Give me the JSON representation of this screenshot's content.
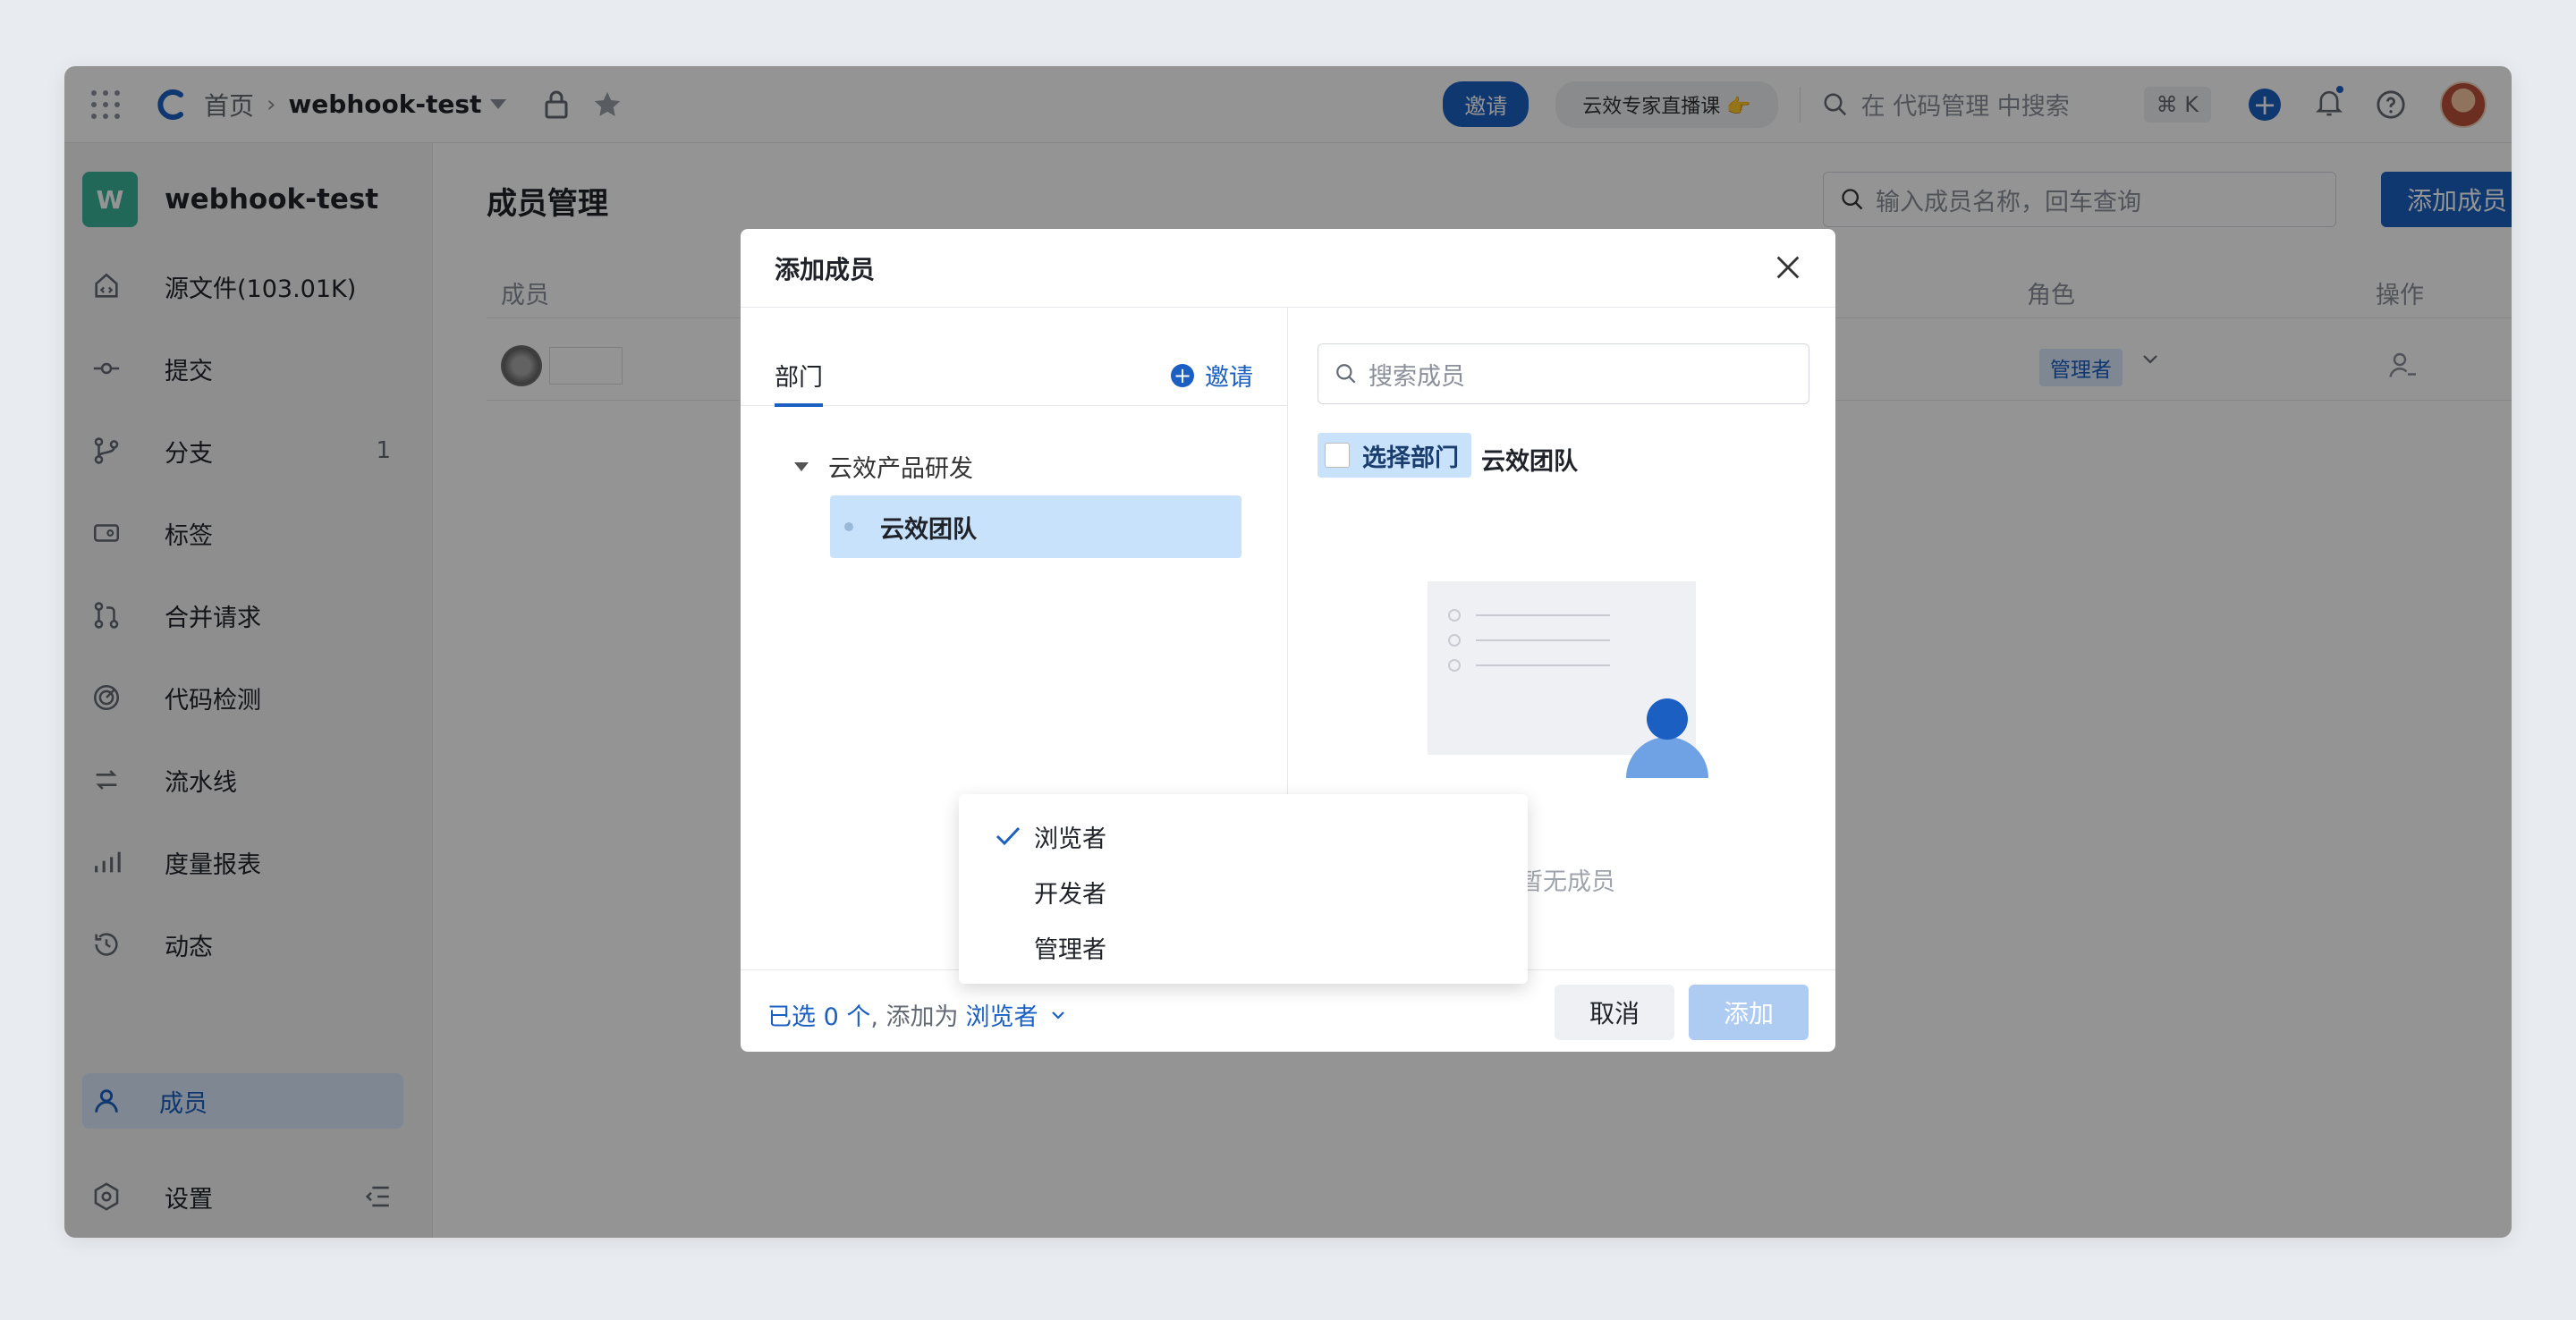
{
  "topbar": {
    "home": "首页",
    "repo": "webhook-test",
    "invite": "邀请",
    "promo": "云效专家直播课 👉",
    "search_placeholder": "在 代码管理 中搜索",
    "shortcut": "⌘ K"
  },
  "sidebar": {
    "repo_initial": "W",
    "repo_name": "webhook-test",
    "items": [
      {
        "label": "源文件(103.01K)",
        "icon": "file-code-icon"
      },
      {
        "label": "提交",
        "icon": "commit-icon"
      },
      {
        "label": "分支",
        "icon": "branch-icon",
        "count": "1"
      },
      {
        "label": "标签",
        "icon": "tag-icon"
      },
      {
        "label": "合并请求",
        "icon": "merge-request-icon"
      },
      {
        "label": "代码检测",
        "icon": "code-scan-icon"
      },
      {
        "label": "流水线",
        "icon": "pipeline-icon"
      },
      {
        "label": "度量报表",
        "icon": "bar-chart-icon"
      },
      {
        "label": "动态",
        "icon": "history-icon"
      }
    ],
    "members": "成员",
    "settings": "设置"
  },
  "main": {
    "title": "成员管理",
    "search_placeholder": "输入成员名称，回车查询",
    "add_member": "添加成员",
    "columns": {
      "member": "成员",
      "role": "角色",
      "action": "操作"
    },
    "row": {
      "role": "管理者"
    }
  },
  "modal": {
    "title": "添加成员",
    "tab_dept": "部门",
    "tab_invite": "邀请",
    "tree_parent": "云效产品研发",
    "tree_child": "云效团队",
    "search_placeholder": "搜索成员",
    "select_dept": "选择部门",
    "team": "云效团队",
    "empty": "暂无成员",
    "footer": {
      "selected": "已选 0 个",
      "add_as": ", 添加为",
      "role": "浏览者"
    },
    "cancel": "取消",
    "add": "添加"
  },
  "dropdown": {
    "options": [
      "浏览者",
      "开发者",
      "管理者"
    ],
    "selected": "浏览者"
  },
  "colors": {
    "accent": "#1a5fc1",
    "selection": "#c8e2fb",
    "badge": "#3bb39a"
  }
}
